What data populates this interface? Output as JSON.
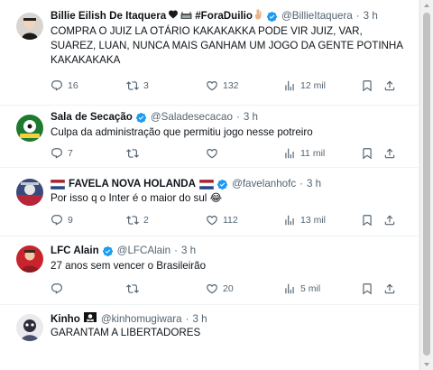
{
  "tweets": [
    {
      "name": "Billie Eilish De Itaquera",
      "name_suffix": "#ForaDuilio",
      "handle": "@BillieItaquera",
      "time": "3 h",
      "text": "COMPRA O JUIZ LA OTÁRIO KAKAKAKKA PODE VIR JUIZ, VAR, SUAREZ, LUAN, NUNCA MAIS GANHAM UM JOGO DA GENTE POTINHA KAKAKAKAKA",
      "replies": "16",
      "retweets": "3",
      "likes": "132",
      "views": "12 mil"
    },
    {
      "name": "Sala de Secação",
      "handle": "@Saladesecacao",
      "time": "3 h",
      "text": "Culpa da administração que permitiu jogo nesse potreiro",
      "replies": "7",
      "retweets": "",
      "likes": "",
      "views": "11 mil"
    },
    {
      "name": "FAVELA NOVA HOLANDA",
      "handle": "@favelanhofc",
      "time": "3 h",
      "text": "Por isso q o Inter é o maior do sul",
      "text_emoji": "😂",
      "replies": "9",
      "retweets": "2",
      "likes": "112",
      "views": "13 mil"
    },
    {
      "name": "LFC Alain",
      "handle": "@LFCAlain",
      "time": "3 h",
      "text": "27 anos sem vencer o Brasileirão",
      "replies": "",
      "retweets": "",
      "likes": "20",
      "views": "5 mil"
    },
    {
      "name": "Kinho",
      "handle": "@kinhomugiwara",
      "time": "3 h",
      "text": "GARANTAM A LIBERTADORES"
    }
  ],
  "icons": {
    "reply": "reply-icon",
    "retweet": "retweet-icon",
    "like": "heart-icon",
    "views": "views-icon",
    "bookmark": "bookmark-icon",
    "share": "share-icon",
    "verified": "verified-badge-icon"
  },
  "colors": {
    "verified": "#1d9bf0",
    "secondary_text": "#536471",
    "divider": "#eff3f4"
  }
}
